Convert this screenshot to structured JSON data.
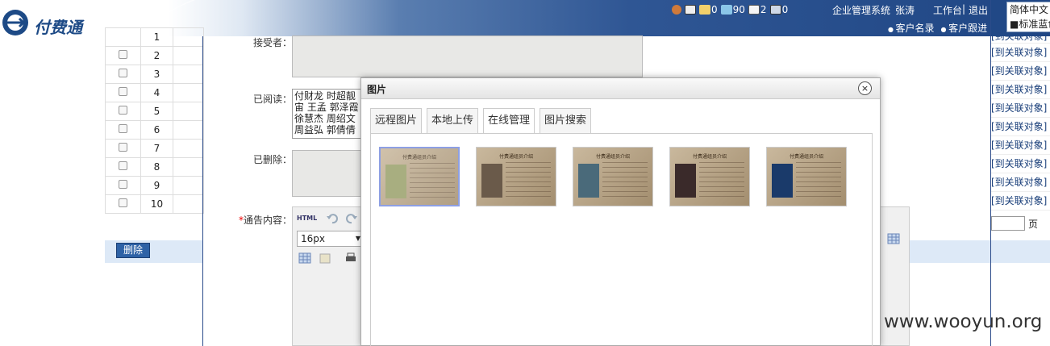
{
  "header": {
    "brand": "付费通",
    "counters": {
      "mail": "0",
      "message": "90",
      "task": "2",
      "notice": "0"
    },
    "system_name": "企业管理系统",
    "user_name": "张涛",
    "workbench": "工作台",
    "sep": "|",
    "logout": "退出",
    "nav": [
      "客户名录",
      "客户跟进"
    ],
    "lang": "简体中文",
    "skin": "■标准蓝色"
  },
  "table": {
    "partial_row": "1",
    "rows": [
      "2",
      "3",
      "4",
      "5",
      "6",
      "7",
      "8",
      "9",
      "10"
    ],
    "delete_label": "删除"
  },
  "form": {
    "receiver_label": "接受者：",
    "read_label": "已阅读：",
    "read_names": "付财龙 时超靓 宙 王孟 郭泽霞 徐慧杰 周绍文 周益弘 郭倩倩",
    "deleted_label": "已删除：",
    "content_label": "通告内容：",
    "required_mark": "*",
    "html_btn": "HTML",
    "font_size": "16px"
  },
  "right_col": {
    "link_label": "[到关联对象]",
    "link_count": 10,
    "pager_page": "页"
  },
  "dialog": {
    "title": "图片",
    "close": "×",
    "tabs": [
      "远程图片",
      "本地上传",
      "在线管理",
      "图片搜索"
    ],
    "active_tab": 2,
    "thumb_title": "付费通组员介绍",
    "thumb_count": 5,
    "selected_thumb": 0
  },
  "watermark": "www.wooyun.org",
  "colors": {
    "header_blue": "#2f5694",
    "link_blue": "#1a3f7a",
    "delete_bg": "#2e62a6"
  }
}
